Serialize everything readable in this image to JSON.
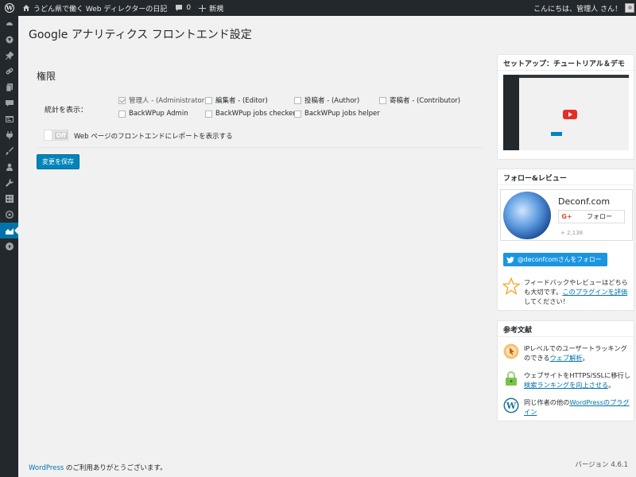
{
  "adminbar": {
    "site_title": "うどん県で働く Web ディレクターの日記",
    "comments_count": "0",
    "new_label": "新規",
    "greeting": "こんにちは、管理人 さん！"
  },
  "sidebar": {
    "items": [
      "dashboard-icon",
      "jetpack-icon",
      "pin-icon",
      "links-icon",
      "pages-icon",
      "comments-icon",
      "appearance-icon",
      "plugins-icon",
      "tools-brush-icon",
      "users-icon",
      "wrench-icon",
      "settings-icon",
      "gauge-icon",
      "analytics-icon",
      "play-icon"
    ],
    "active_index": 13
  },
  "page": {
    "title": "Google アナリティクス フロントエンド設定"
  },
  "permissions": {
    "section_title": "権限",
    "row_label": "統計を表示：",
    "roles": [
      {
        "label": "管理人 - (Administrator)",
        "checked": true,
        "disabled": true
      },
      {
        "label": "編集者 - (Editor)",
        "checked": false,
        "disabled": false
      },
      {
        "label": "投稿者 - (Author)",
        "checked": false,
        "disabled": false
      },
      {
        "label": "寄稿者 - (Contributor)",
        "checked": false,
        "disabled": false
      },
      {
        "label": "BackWPup Admin",
        "checked": false,
        "disabled": false
      },
      {
        "label": "BackWPup jobs checker",
        "checked": false,
        "disabled": false
      },
      {
        "label": "BackWPup jobs helper",
        "checked": false,
        "disabled": false
      }
    ],
    "toggle_state": "Off",
    "toggle_label": "Web ページのフロントエンドにレポートを表示する",
    "save_label": "変更を保存"
  },
  "widgets": {
    "tutorial_title": "セットアップ：チュートリアル＆デモ",
    "follow_title": "フォロー&レビュー",
    "gplus_name": "Deconf.com",
    "gplus_follow": "フォロー",
    "gplus_g": "G+",
    "gplus_count": "+ 2,138",
    "twitter_button": "@deconfcomさんをフォロー",
    "feedback_pre": "フィードバックやレビューはどちらも大切です。",
    "feedback_link": "このプラグインを評価",
    "feedback_post": "してください！",
    "reference_title": "参考文献",
    "refs": [
      {
        "pre": "IPレベルでのユーザートラッキングのできる",
        "link": "ウェブ解析",
        "post": "。"
      },
      {
        "pre": "ウェブサイトをHTTPS/SSLに移行し",
        "link": "検索ランキングを向上させる",
        "post": "。"
      },
      {
        "pre": "同じ作者の他の",
        "link": "WordPressのプラグイン",
        "post": ""
      }
    ]
  },
  "footer": {
    "thanks_link": "WordPress",
    "thanks_text": " のご利用ありがとうございます。",
    "version": "バージョン 4.6.1"
  },
  "colors": {
    "adminbar": "#23282d",
    "accent": "#0073aa",
    "primary_button": "#0085ba",
    "twitter": "#1b95e0",
    "star": "#f6a623"
  }
}
